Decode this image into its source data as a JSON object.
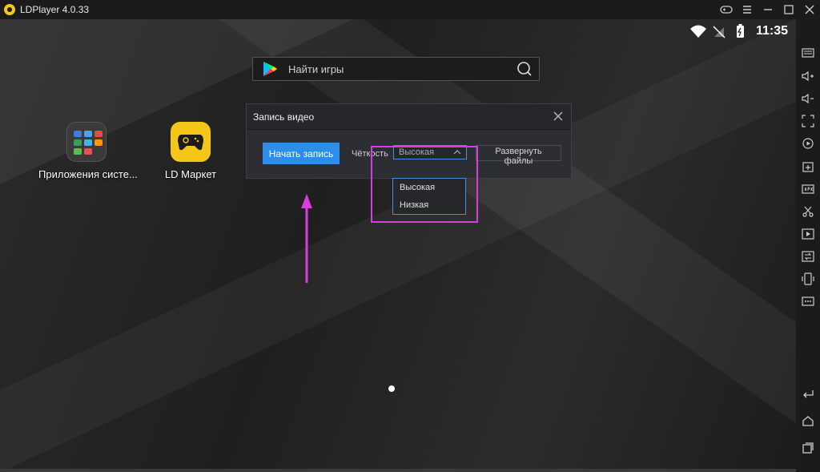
{
  "window": {
    "title": "LDPlayer 4.0.33"
  },
  "statusbar": {
    "time": "11:35"
  },
  "search": {
    "placeholder": "Найти игры"
  },
  "apps": [
    {
      "label": "Приложения систе..."
    },
    {
      "label": "LD Маркет"
    }
  ],
  "dialog": {
    "title": "Запись видео",
    "start_label": "Начать запись",
    "quality_label": "Чёткость",
    "quality_value": "Высокая",
    "expand_label": "Развернуть файлы",
    "options": [
      "Высокая",
      "Низкая"
    ]
  },
  "colors": {
    "accent": "#2d8ee8",
    "highlight": "#d83de0",
    "ldmarket": "#f5c518"
  }
}
